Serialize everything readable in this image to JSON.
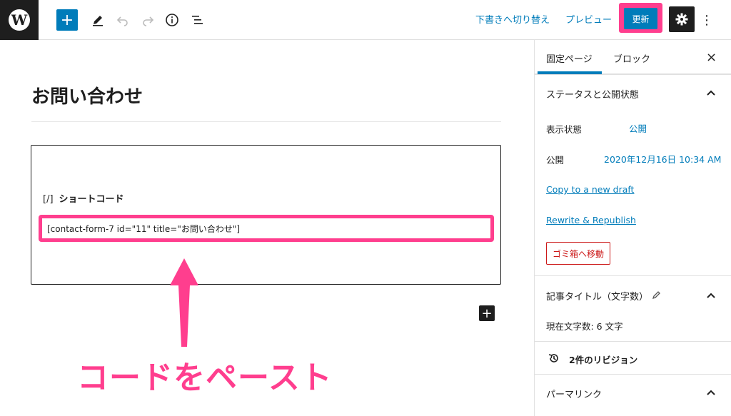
{
  "toolbar": {
    "wp_logo": "W",
    "add_label": "+",
    "switch_draft": "下書きへ切り替え",
    "preview": "プレビュー",
    "update": "更新",
    "more": "⋮"
  },
  "editor": {
    "page_title": "お問い合わせ",
    "shortcode_bracket": "[/]",
    "shortcode_label": "ショートコード",
    "shortcode_value": "[contact-form-7 id=\"11\" title=\"お問い合わせ\"]",
    "inserter_label": "+",
    "annotation": "コードをペースト"
  },
  "sidebar": {
    "tab_page": "固定ページ",
    "tab_block": "ブロック",
    "close": "×",
    "status_title": "ステータスと公開状態",
    "visibility_label": "表示状態",
    "visibility_value": "公開",
    "publish_label": "公開",
    "publish_value": "2020年12月16日 10:34 AM",
    "copy_draft": "Copy to a new draft",
    "rewrite": "Rewrite & Republish",
    "trash": "ゴミ箱へ移動",
    "title_count_heading": "記事タイトル（文字数）",
    "title_count_value": "現在文字数: 6 文字",
    "revisions": "2件のリビジョン",
    "permalink": "パーマリンク"
  },
  "colors": {
    "accent": "#007cba",
    "highlight": "#ff3e8e",
    "danger": "#cc1818"
  }
}
